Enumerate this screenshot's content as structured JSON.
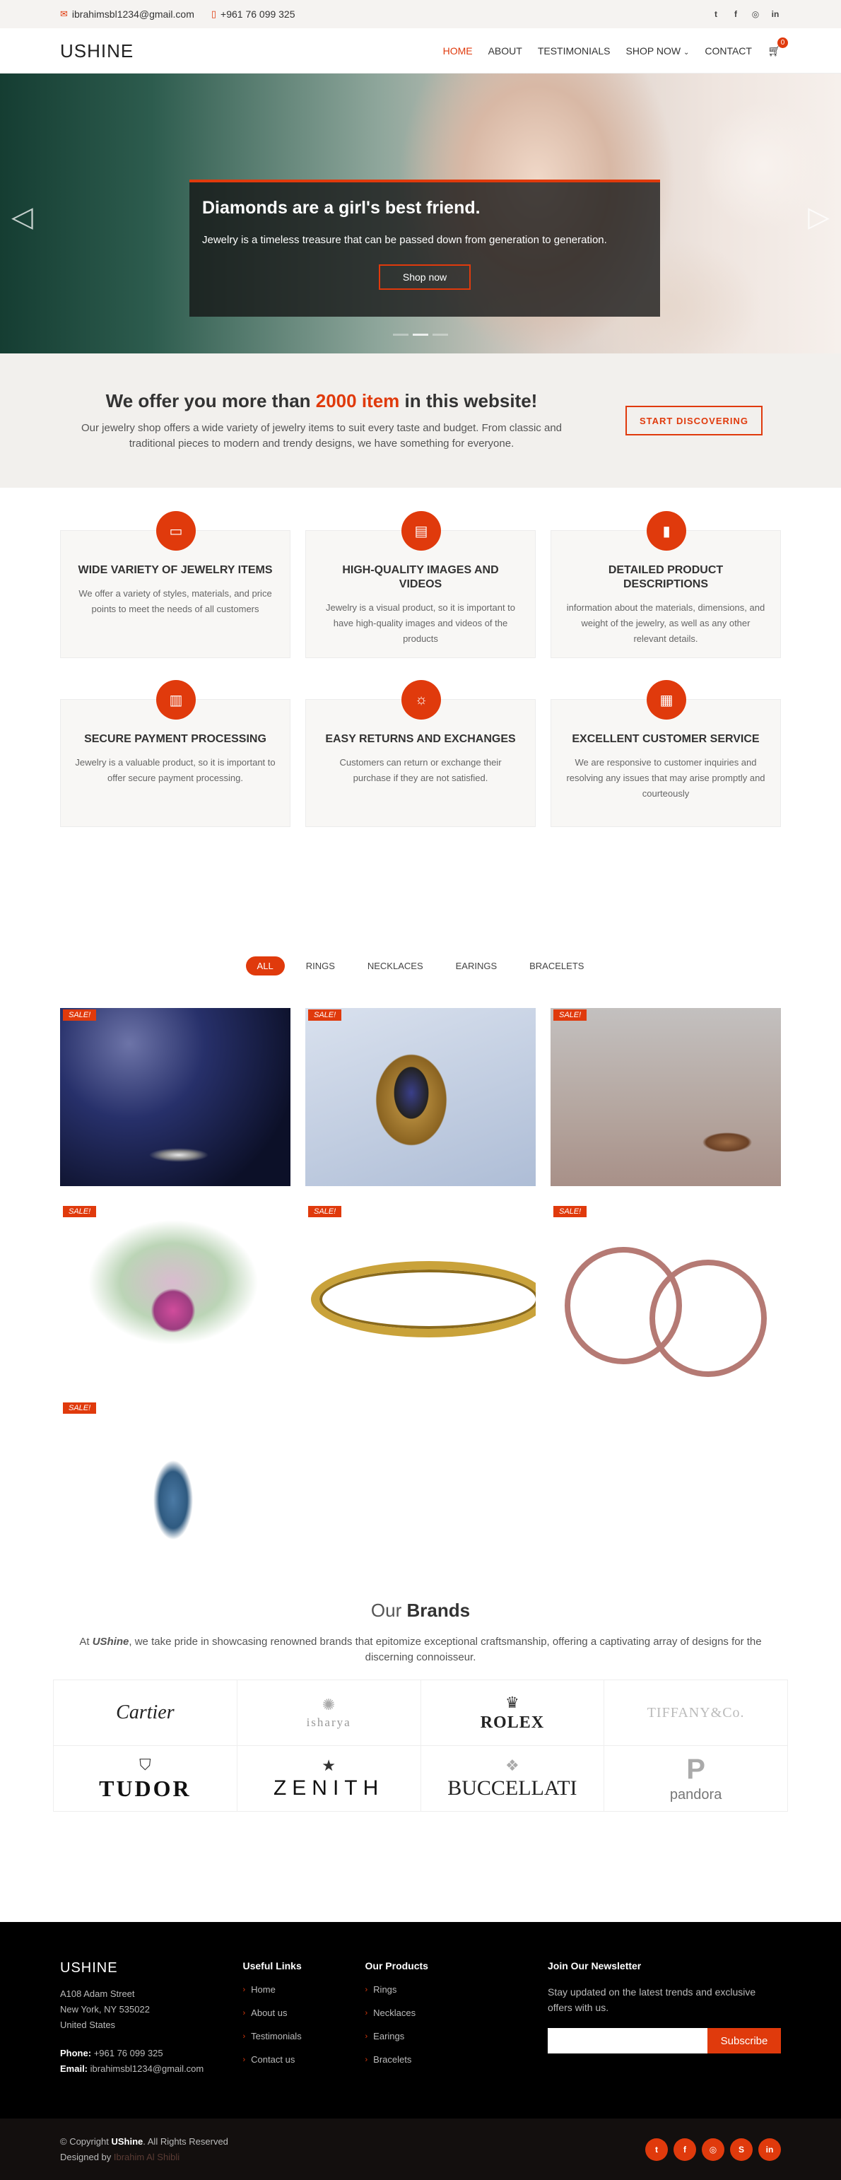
{
  "topbar": {
    "email": "ibrahimsbl1234@gmail.com",
    "phone": "+961 76 099 325",
    "social": [
      "twitter-icon",
      "facebook-icon",
      "instagram-icon",
      "linkedin-icon"
    ]
  },
  "header": {
    "logo": "USHINE",
    "nav": [
      "HOME",
      "ABOUT",
      "TESTIMONIALS",
      "SHOP NOW",
      "CONTACT"
    ],
    "cart_count": "0"
  },
  "hero": {
    "title": "Diamonds are a girl's best friend.",
    "text": "Jewelry is a timeless treasure that can be passed down from generation to generation.",
    "button": "Shop now"
  },
  "offer": {
    "title_pre": "We offer you more than ",
    "title_highlight": "2000 item",
    "title_post": " in this website!",
    "text": "Our jewelry shop offers a wide variety of jewelry items to suit every taste and budget. From classic and traditional pieces to modern and trendy designs, we have something for everyone.",
    "button": "START DISCOVERING"
  },
  "features": [
    {
      "title": "WIDE VARIETY OF JEWELRY ITEMS",
      "text": "We offer a variety of styles, materials, and price points to meet the needs of all customers",
      "icon": "briefcase-icon"
    },
    {
      "title": "HIGH-QUALITY IMAGES AND VIDEOS",
      "text": "Jewelry is a visual product, so it is important to have high-quality images and videos of the products",
      "icon": "card-icon"
    },
    {
      "title": "DETAILED PRODUCT DESCRIPTIONS",
      "text": "information about the materials, dimensions, and weight of the jewelry, as well as any other relevant details.",
      "icon": "bar-chart-icon"
    },
    {
      "title": "SECURE PAYMENT PROCESSING",
      "text": "Jewelry is a valuable product, so it is important to offer secure payment processing.",
      "icon": "building-icon"
    },
    {
      "title": "EASY RETURNS AND EXCHANGES",
      "text": "Customers can return or exchange their purchase if they are not satisfied.",
      "icon": "sun-icon"
    },
    {
      "title": "EXCELLENT CUSTOMER SERVICE",
      "text": "We are responsive to customer inquiries and resolving any issues that may arise promptly and courteously",
      "icon": "calendar-icon"
    }
  ],
  "portfolio": {
    "filters": [
      "ALL",
      "RINGS",
      "NECKLACES",
      "EARINGS",
      "BRACELETS"
    ],
    "sale_label": "SALE!",
    "items": [
      "ring-on-blue",
      "gold-sapphire-ring",
      "bracelet-on-wrist",
      "gem-necklace",
      "gold-bangle",
      "rose-gold-bangles",
      "blue-brooch"
    ]
  },
  "brands": {
    "title_light": "Our ",
    "title_bold": "Brands",
    "text_pre": "At ",
    "text_brand": "UShine",
    "text_post": ", we take pride in showcasing renowned brands that epitomize exceptional craftsmanship, offering a captivating array of designs for the discerning connoisseur.",
    "logos": [
      "Cartier",
      "isharya",
      "ROLEX",
      "TIFFANY&Co.",
      "TUDOR",
      "ZENITH",
      "BUCCELLATI",
      "pandora"
    ]
  },
  "footer": {
    "logo": "USHINE",
    "address": [
      "A108 Adam Street",
      "New York, NY 535022",
      "United States"
    ],
    "phone_label": "Phone:",
    "phone": "+961 76 099 325",
    "email_label": "Email:",
    "email": "ibrahimsbl1234@gmail.com",
    "useful_title": "Useful Links",
    "useful": [
      "Home",
      "About us",
      "Testimonials",
      "Contact us"
    ],
    "brands_title": "Our Products",
    "products": [
      "Rings",
      "Necklaces",
      "Earings",
      "Bracelets"
    ],
    "newsletter_title": "Join Our Newsletter",
    "newsletter_text": "Stay updated on the latest trends and exclusive offers with us.",
    "subscribe": "Subscribe"
  },
  "copyright": {
    "pre": "© Copyright ",
    "brand": "UShine",
    "post": ". All Rights Reserved",
    "designed_pre": "Designed by ",
    "designer": "Ibrahim Al Shibli"
  },
  "colors": {
    "accent": "#e03a0c",
    "dark": "#000000"
  }
}
